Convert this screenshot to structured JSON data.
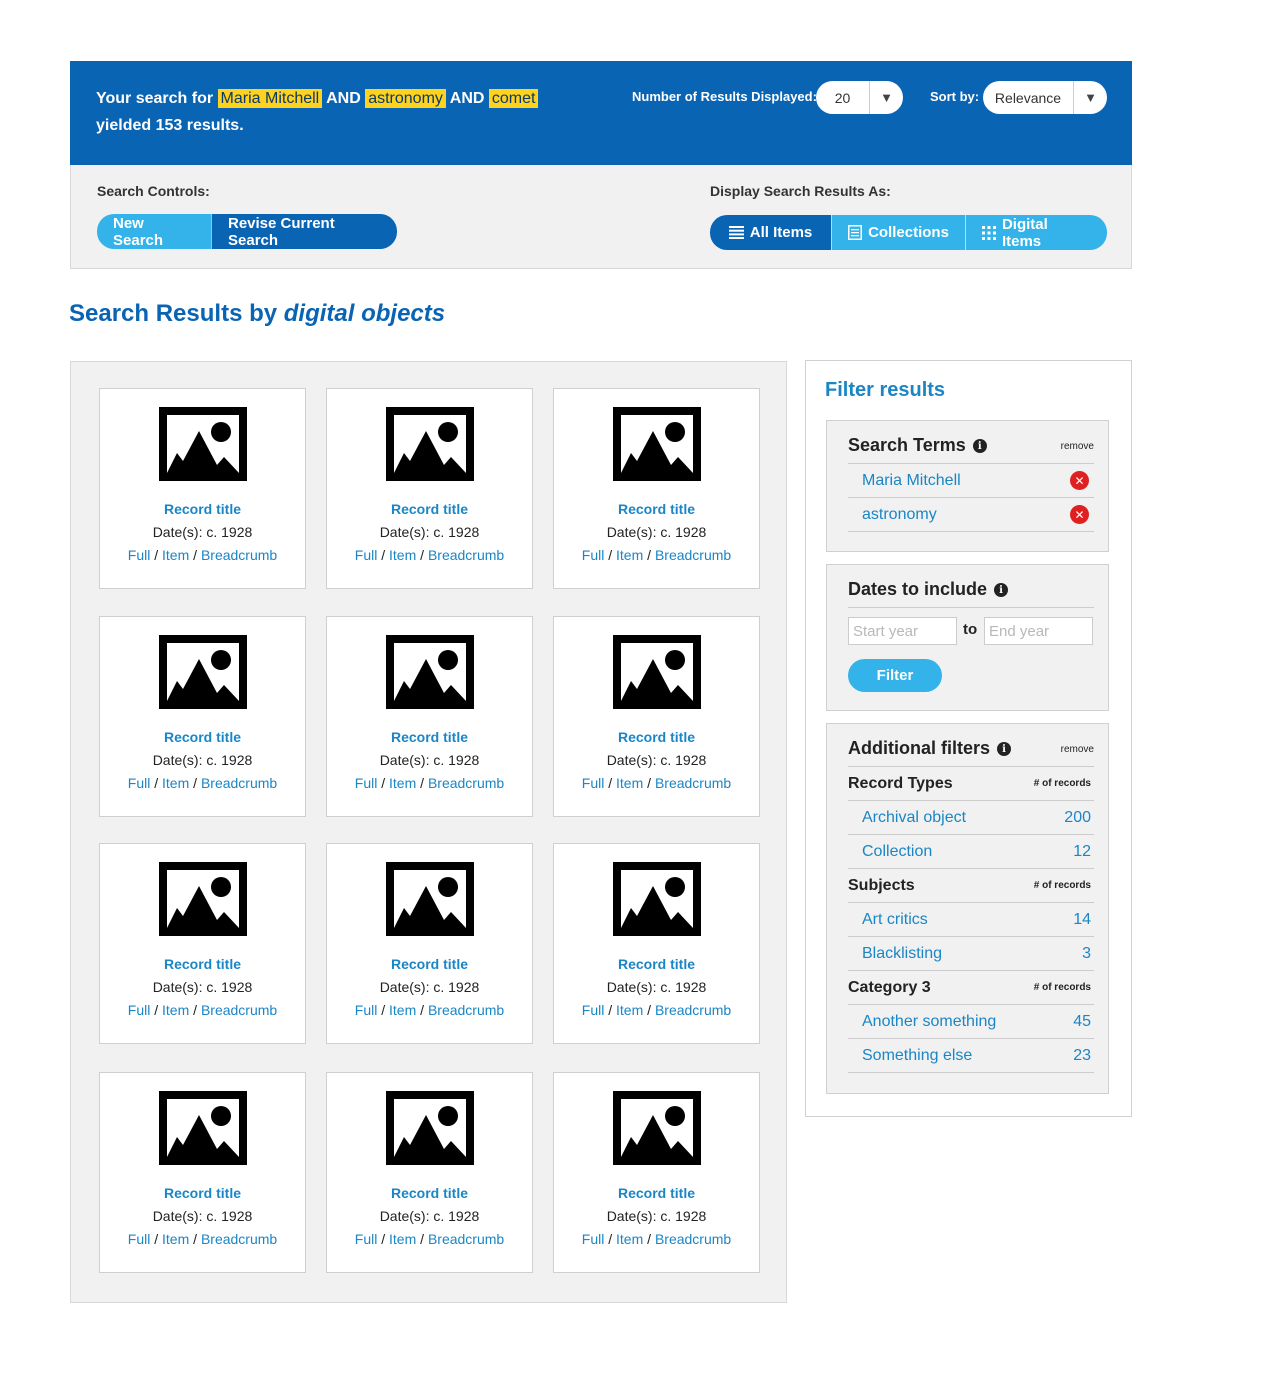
{
  "header": {
    "summary_prefix": "Your search for",
    "terms": [
      "Maria Mitchell",
      "astronomy",
      "comet"
    ],
    "connector": "AND",
    "summary_suffix": "yielded 153 results.",
    "results_label": "Number of Results Displayed:",
    "results_value": "20",
    "sort_label": "Sort by:",
    "sort_value": "Relevance"
  },
  "controls": {
    "search_label": "Search Controls:",
    "new_search": "New Search",
    "revise_search": "Revise Current Search",
    "display_label": "Display Search Results As:",
    "all_items": "All Items",
    "collections": "Collections",
    "digital_items": "Digital Items"
  },
  "heading": {
    "prefix": "Search Results by",
    "emph": "digital objects"
  },
  "cards": [
    {
      "title": "Record title",
      "date": "Date(s): c. 1928",
      "full": "Full",
      "item": "Item",
      "breadcrumb": "Breadcrumb"
    },
    {
      "title": "Record title",
      "date": "Date(s): c. 1928",
      "full": "Full",
      "item": "Item",
      "breadcrumb": "Breadcrumb"
    },
    {
      "title": "Record title",
      "date": "Date(s): c. 1928",
      "full": "Full",
      "item": "Item",
      "breadcrumb": "Breadcrumb"
    },
    {
      "title": "Record title",
      "date": "Date(s): c. 1928",
      "full": "Full",
      "item": "Item",
      "breadcrumb": "Breadcrumb"
    },
    {
      "title": "Record title",
      "date": "Date(s): c. 1928",
      "full": "Full",
      "item": "Item",
      "breadcrumb": "Breadcrumb"
    },
    {
      "title": "Record title",
      "date": "Date(s): c. 1928",
      "full": "Full",
      "item": "Item",
      "breadcrumb": "Breadcrumb"
    },
    {
      "title": "Record title",
      "date": "Date(s): c. 1928",
      "full": "Full",
      "item": "Item",
      "breadcrumb": "Breadcrumb"
    },
    {
      "title": "Record title",
      "date": "Date(s): c. 1928",
      "full": "Full",
      "item": "Item",
      "breadcrumb": "Breadcrumb"
    },
    {
      "title": "Record title",
      "date": "Date(s): c. 1928",
      "full": "Full",
      "item": "Item",
      "breadcrumb": "Breadcrumb"
    },
    {
      "title": "Record title",
      "date": "Date(s): c. 1928",
      "full": "Full",
      "item": "Item",
      "breadcrumb": "Breadcrumb"
    },
    {
      "title": "Record title",
      "date": "Date(s): c. 1928",
      "full": "Full",
      "item": "Item",
      "breadcrumb": "Breadcrumb"
    },
    {
      "title": "Record title",
      "date": "Date(s): c. 1928",
      "full": "Full",
      "item": "Item",
      "breadcrumb": "Breadcrumb"
    }
  ],
  "sidebar": {
    "title": "Filter results",
    "search_terms": {
      "heading": "Search Terms",
      "remove": "remove",
      "items": [
        "Maria Mitchell",
        "astronomy"
      ]
    },
    "dates": {
      "heading": "Dates to include",
      "start_placeholder": "Start year",
      "to": "to",
      "end_placeholder": "End year",
      "filter": "Filter"
    },
    "additional": {
      "heading": "Additional filters",
      "remove": "remove",
      "count_label": "# of records",
      "categories": [
        {
          "name": "Record Types",
          "items": [
            {
              "label": "Archival object",
              "count": "200"
            },
            {
              "label": "Collection",
              "count": "12"
            }
          ]
        },
        {
          "name": "Subjects",
          "items": [
            {
              "label": "Art critics",
              "count": "14"
            },
            {
              "label": "Blacklisting",
              "count": "3"
            }
          ]
        },
        {
          "name": "Category 3",
          "items": [
            {
              "label": "Another something",
              "count": "45"
            },
            {
              "label": "Something else",
              "count": "23"
            }
          ]
        }
      ]
    }
  },
  "icons": {
    "image_placeholder": "image-icon",
    "info": "info-icon",
    "remove": "remove-x-icon",
    "list": "list-icon",
    "collections": "document-icon",
    "grid": "grid-icon",
    "caret": "chevron-down-icon"
  },
  "colors": {
    "header_bg": "#0a64b4",
    "highlight": "#ffd21e",
    "accent_light": "#33b3ea",
    "link": "#1a86c6",
    "remove_red": "#e02020"
  }
}
